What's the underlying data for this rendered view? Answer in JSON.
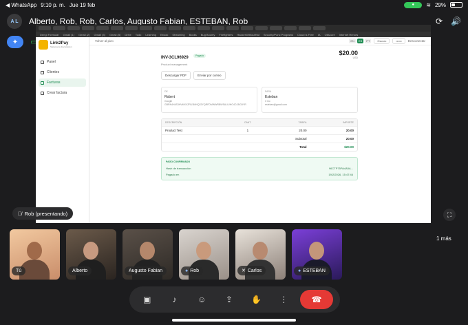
{
  "status": {
    "back_app": "◀ WhatsApp",
    "time": "9:10 p. m.",
    "date": "Jue 19 feb",
    "battery": "29%"
  },
  "call": {
    "avatar_text": "A L",
    "title": "Alberto, Rob, Rob, Carlos, Augusto Fabian, ESTEBAN, Rob"
  },
  "shared": {
    "bookmarks": [
      "Dengi Formular",
      "Gmail (1)",
      "Gmail (2)",
      "Gmail (3)",
      "Gmail (5)",
      "Drive",
      "Todo",
      "Learning",
      "Ebook",
      "Streaming",
      "Books",
      "Bug Bounty",
      "Firefighters",
      "HackerWithoutHat",
      "Security/Ponc Programs",
      "Cloud is Free",
      "IA",
      "Obscure",
      "Internet Heroes"
    ],
    "app": {
      "brand": "Link2Pay",
      "brand_sub": "Sistema de Facturacion",
      "nav": [
        "Panel",
        "Clientes",
        "Facturas",
        "Crear factura"
      ],
      "back_link": "Volver al pizo",
      "langs": [
        "EN",
        "ES",
        "PT"
      ],
      "dark_label": "Oscuro",
      "disconnect": "Desconectar"
    },
    "invoice": {
      "id": "INV-3CL96929",
      "status": "Pagado",
      "subtitle": "Product management",
      "amount": "$20.00",
      "currency": "USD",
      "btn_pdf": "Descargar PDF",
      "btn_email": "Enviar por correo",
      "from": {
        "label": "DE",
        "name": "Robert",
        "line1": "Google",
        "line2": "GBRN4H4S3HVMXVZRU3MNQ2ZYQRFDMWWRBWSALIUHO4C43IGIIYR"
      },
      "to": {
        "label": "PARA",
        "name": "Esteban",
        "line1": "X inc",
        "line2": "esteban@gmail.com"
      },
      "headers": [
        "DESCRIPCIÓN",
        "CANT.",
        "TARIFA",
        "IMPORTE"
      ],
      "item": {
        "desc": "Product Test",
        "qty": "1",
        "rate": "20.00",
        "amount": "20.00"
      },
      "subtotal_label": "Subtotal",
      "subtotal": "20.00",
      "total_label": "Total",
      "total": "$20.00",
      "paid": {
        "title": "PAGO CONFIRMADO",
        "hash_label": "Hash de transacción",
        "hash": "96CTP75PA4A5A...",
        "date_label": "Pagado en",
        "date": "19/2/2026, 15:47:46"
      }
    }
  },
  "presenting_label": "Rob (presentando)",
  "participants": [
    "Tú",
    "Alberto",
    "Augusto Fabian",
    "Rob",
    "Carlos",
    "ESTEBAN"
  ],
  "more_label": "1 más",
  "colors": {
    "accent": "#1e8c52",
    "end_call": "#e53935",
    "gemini": "#4285f4"
  }
}
